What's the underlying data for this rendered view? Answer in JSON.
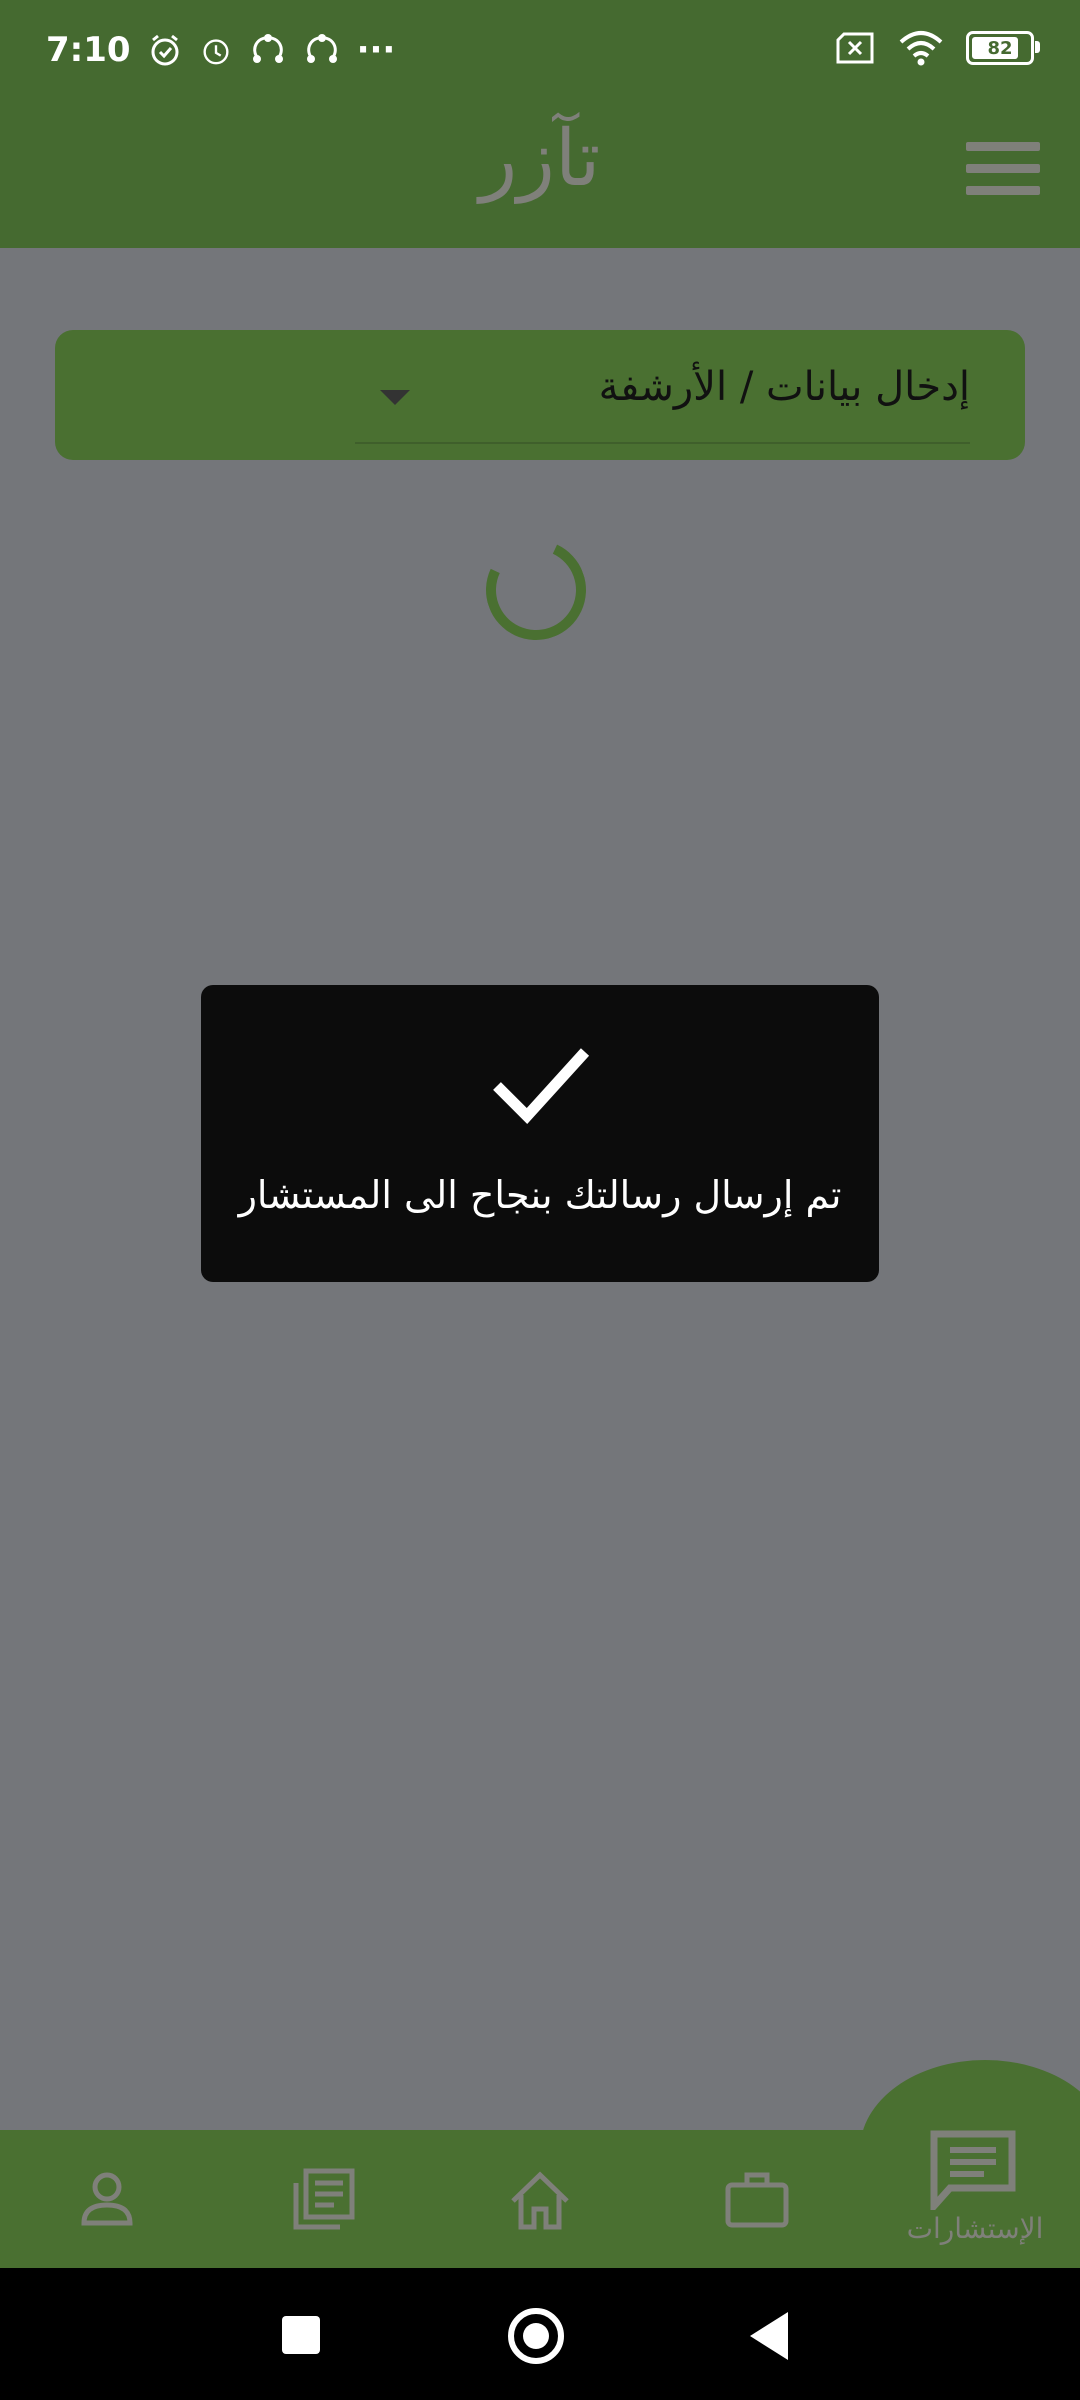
{
  "status_bar": {
    "time": "7:10",
    "more": "···",
    "battery_level": "82"
  },
  "app_bar": {
    "title": "تآزر"
  },
  "dropdown": {
    "selected_label": "إدخال بيانات / الأرشفة"
  },
  "toast": {
    "message": "تم إرسال رسالتك بنجاح الى المستشار"
  },
  "bottom_nav": {
    "active_label": "الإستشارات",
    "items": [
      {
        "icon": "profile-icon"
      },
      {
        "icon": "articles-icon"
      },
      {
        "icon": "home-icon"
      },
      {
        "icon": "briefcase-icon"
      },
      {
        "icon": "chat-icon"
      }
    ]
  },
  "colors": {
    "primary": "#456a30",
    "overlay": "#74767a",
    "toast_bg": "#0c0c0c",
    "muted_icon": "#7f807a"
  }
}
